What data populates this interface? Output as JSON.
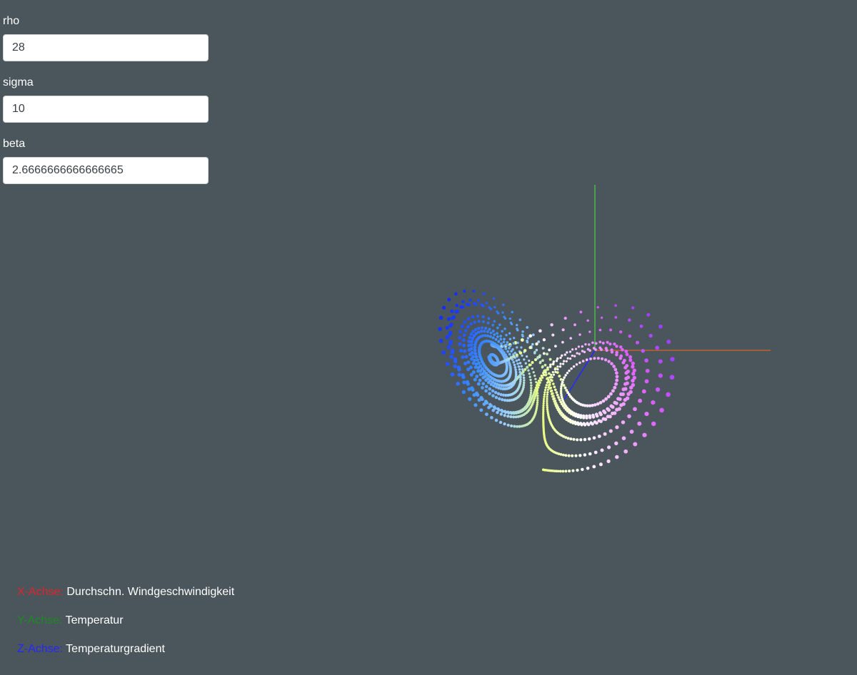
{
  "controls": [
    {
      "label": "rho",
      "value": "28"
    },
    {
      "label": "sigma",
      "value": "10"
    },
    {
      "label": "beta",
      "value": "2.6666666666666665"
    }
  ],
  "legend": [
    {
      "axis": "X-Achse:",
      "description": "Durchschn. Windgeschwindigkeit",
      "color": "#e0242a"
    },
    {
      "axis": "Y-Achse:",
      "description": "Temperatur",
      "color": "#1f8a24"
    },
    {
      "axis": "Z-Achse:",
      "description": "Temperaturgradient",
      "color": "#2626ff"
    }
  ],
  "scene": {
    "background": "#4b555c",
    "axis_colors": {
      "x": "#c0622e",
      "y": "#4fb04a",
      "z": "#2a2aff"
    },
    "gradient_colors": [
      "#1010f0",
      "#1a3cff",
      "#3a8cff",
      "#9ad0ff",
      "#e8ff80",
      "#ffffff",
      "#f4b8ff",
      "#e060ff",
      "#a040ff"
    ]
  }
}
